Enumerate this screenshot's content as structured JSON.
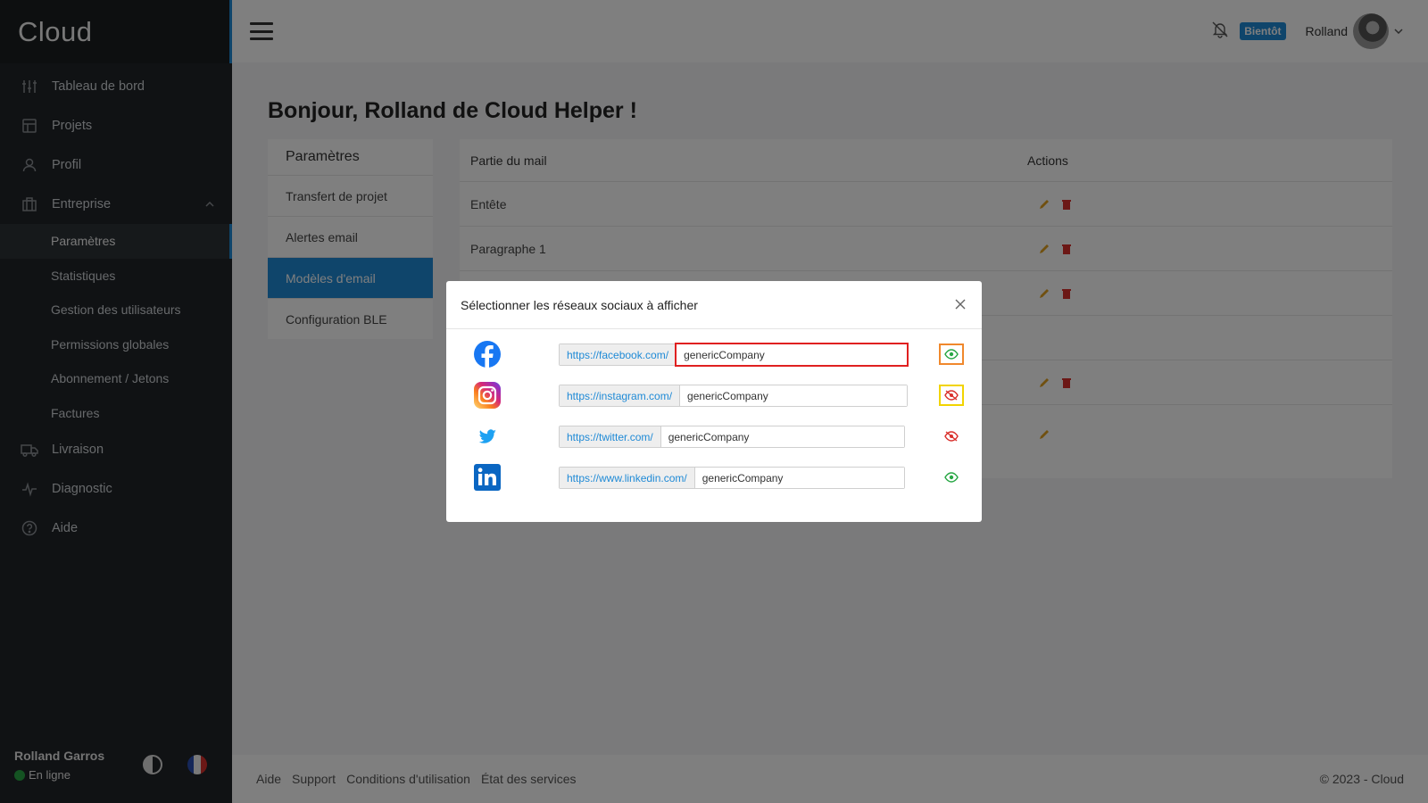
{
  "app": {
    "brand": "Cloud"
  },
  "sidebar": {
    "items": [
      {
        "label": "Tableau de bord"
      },
      {
        "label": "Projets"
      },
      {
        "label": "Profil"
      },
      {
        "label": "Entreprise"
      },
      {
        "label": "Livraison"
      },
      {
        "label": "Diagnostic"
      },
      {
        "label": "Aide"
      }
    ],
    "entreprise_sub": [
      {
        "label": "Paramètres"
      },
      {
        "label": "Statistiques"
      },
      {
        "label": "Gestion des utilisateurs"
      },
      {
        "label": "Permissions globales"
      },
      {
        "label": "Abonnement / Jetons"
      },
      {
        "label": "Factures"
      }
    ],
    "user": {
      "name": "Rolland Garros",
      "status": "En ligne"
    }
  },
  "topbar": {
    "badge": "Bientôt",
    "username": "Rolland"
  },
  "main": {
    "title": "Bonjour, Rolland de Cloud Helper !",
    "settings_menu": {
      "title": "Paramètres",
      "items": [
        {
          "label": "Transfert de projet"
        },
        {
          "label": "Alertes email"
        },
        {
          "label": "Modèles d'email"
        },
        {
          "label": "Configuration BLE"
        }
      ]
    },
    "table": {
      "headers": {
        "part": "Partie du mail",
        "actions": "Actions"
      },
      "rows": [
        {
          "part": "Entête"
        },
        {
          "part": "Paragraphe 1"
        }
      ]
    }
  },
  "footer": {
    "links": [
      "Aide",
      "Support",
      "Conditions d'utilisation",
      "État des services"
    ],
    "copyright": "© 2023 - Cloud"
  },
  "modal": {
    "title": "Sélectionner les réseaux sociaux à afficher",
    "socials": [
      {
        "network": "facebook-icon",
        "prefix": "https://facebook.com/",
        "value": "genericCompany",
        "visible": true
      },
      {
        "network": "instagram-icon",
        "prefix": "https://instagram.com/",
        "value": "genericCompany",
        "visible": false
      },
      {
        "network": "twitter-icon",
        "prefix": "https://twitter.com/",
        "value": "genericCompany",
        "visible": false
      },
      {
        "network": "linkedin-icon",
        "prefix": "https://www.linkedin.com/",
        "value": "genericCompany",
        "visible": true
      }
    ]
  },
  "colors": {
    "accent": "#1f8ad6",
    "sidebar": "#212529",
    "edit": "#e0a020",
    "delete": "#d9302c",
    "visible": "#28a745",
    "hidden": "#d9302c"
  }
}
